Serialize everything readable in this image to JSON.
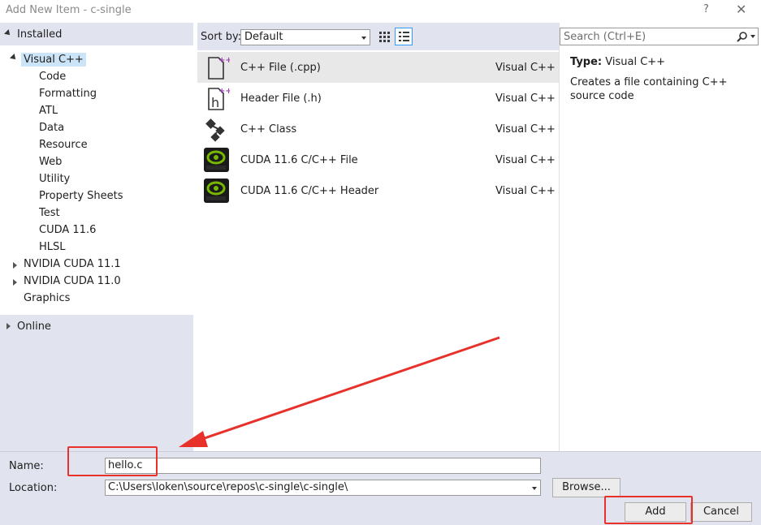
{
  "window": {
    "title": "Add New Item - c-single",
    "help_label": "?",
    "close_label": "✕"
  },
  "left_panel": {
    "installed_label": "Installed",
    "online_label": "Online",
    "tree": [
      {
        "label": "Visual C++",
        "level": 0,
        "selected": true
      },
      {
        "label": "Code",
        "level": 1
      },
      {
        "label": "Formatting",
        "level": 1
      },
      {
        "label": "ATL",
        "level": 1
      },
      {
        "label": "Data",
        "level": 1
      },
      {
        "label": "Resource",
        "level": 1
      },
      {
        "label": "Web",
        "level": 1
      },
      {
        "label": "Utility",
        "level": 1
      },
      {
        "label": "Property Sheets",
        "level": 1
      },
      {
        "label": "Test",
        "level": 1
      },
      {
        "label": "CUDA 11.6",
        "level": 1
      },
      {
        "label": "HLSL",
        "level": 1
      },
      {
        "label": "NVIDIA CUDA 11.1",
        "level": 0
      },
      {
        "label": "NVIDIA CUDA 11.0",
        "level": 0
      },
      {
        "label": "Graphics",
        "level": 0
      }
    ]
  },
  "toolbar": {
    "sort_label": "Sort by:",
    "sort_value": "Default"
  },
  "templates": [
    {
      "name": "C++ File (.cpp)",
      "lang": "Visual C++",
      "icon": "cpp-file-icon",
      "selected": true
    },
    {
      "name": "Header File (.h)",
      "lang": "Visual C++",
      "icon": "header-file-icon"
    },
    {
      "name": "C++ Class",
      "lang": "Visual C++",
      "icon": "cpp-class-icon"
    },
    {
      "name": "CUDA 11.6 C/C++ File",
      "lang": "Visual C++",
      "icon": "nvidia-icon"
    },
    {
      "name": "CUDA 11.6 C/C++ Header",
      "lang": "Visual C++",
      "icon": "nvidia-icon"
    }
  ],
  "details": {
    "search_placeholder": "Search (Ctrl+E)",
    "type_label": "Type:",
    "type_value": "Visual C++",
    "description": "Creates a file containing C++ source code"
  },
  "form": {
    "name_label": "Name:",
    "name_value": "hello.c",
    "location_label": "Location:",
    "location_value": "C:\\Users\\loken\\source\\repos\\c-single\\c-single\\",
    "browse_label": "Browse...",
    "add_label": "Add",
    "cancel_label": "Cancel"
  },
  "colors": {
    "annotation_red": "#e8312b",
    "panel_bg": "#e1e4ef",
    "selection_bg": "#cce4f7"
  }
}
